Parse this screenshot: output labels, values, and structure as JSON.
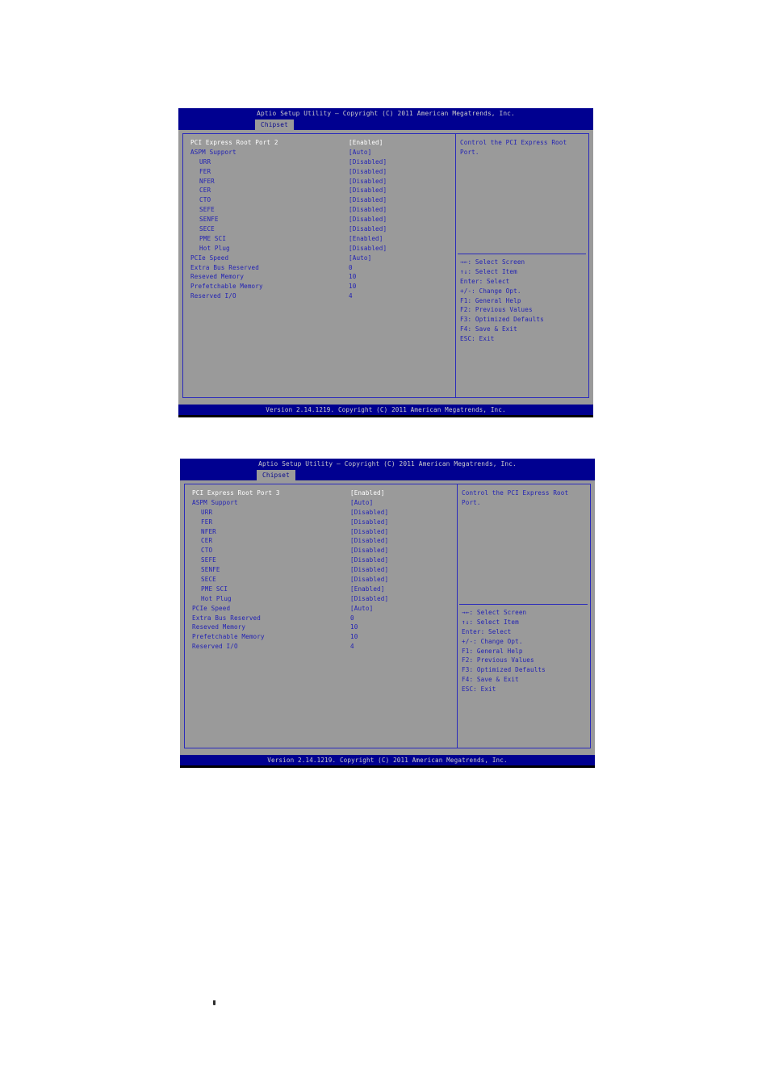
{
  "document": {
    "page_marker": ","
  },
  "screens": [
    {
      "id": "screen-port2",
      "title": "Aptio Setup Utility – Copyright (C) 2011 American Megatrends, Inc.",
      "tab": "Chipset",
      "footer": "Version 2.14.1219. Copyright (C) 2011 American Megatrends, Inc.",
      "help": "Control the PCI Express Root Port.",
      "options": [
        {
          "label": "PCI Express Root Port 2",
          "value": "[Enabled]",
          "indent": false,
          "selected": true
        },
        {
          "label": "ASPM Support",
          "value": "[Auto]",
          "indent": false,
          "selected": false
        },
        {
          "label": "URR",
          "value": "[Disabled]",
          "indent": true,
          "selected": false
        },
        {
          "label": "FER",
          "value": "[Disabled]",
          "indent": true,
          "selected": false
        },
        {
          "label": "NFER",
          "value": "[Disabled]",
          "indent": true,
          "selected": false
        },
        {
          "label": "CER",
          "value": "[Disabled]",
          "indent": true,
          "selected": false
        },
        {
          "label": "CTO",
          "value": "[Disabled]",
          "indent": true,
          "selected": false
        },
        {
          "label": "SEFE",
          "value": "[Disabled]",
          "indent": true,
          "selected": false
        },
        {
          "label": "SENFE",
          "value": "[Disabled]",
          "indent": true,
          "selected": false
        },
        {
          "label": "SECE",
          "value": "[Disabled]",
          "indent": true,
          "selected": false
        },
        {
          "label": "PME SCI",
          "value": "[Enabled]",
          "indent": true,
          "selected": false
        },
        {
          "label": "Hot Plug",
          "value": "[Disabled]",
          "indent": true,
          "selected": false
        },
        {
          "label": "PCIe Speed",
          "value": "[Auto]",
          "indent": false,
          "selected": false
        },
        {
          "label": "Extra Bus Reserved",
          "value": "0",
          "indent": false,
          "selected": false
        },
        {
          "label": "Reseved Memory",
          "value": "10",
          "indent": false,
          "selected": false
        },
        {
          "label": "Prefetchable Memory",
          "value": "10",
          "indent": false,
          "selected": false
        },
        {
          "label": "Reserved I/O",
          "value": "4",
          "indent": false,
          "selected": false
        }
      ],
      "keys": [
        "→←: Select Screen",
        "↑↓: Select Item",
        "Enter: Select",
        "+/-: Change Opt.",
        "F1: General Help",
        "F2: Previous Values",
        "F3: Optimized Defaults",
        "F4: Save & Exit",
        "ESC: Exit"
      ]
    },
    {
      "id": "screen-port3",
      "title": "Aptio Setup Utility – Copyright (C) 2011 American Megatrends, Inc.",
      "tab": "Chipset",
      "footer": "Version 2.14.1219. Copyright (C) 2011 American Megatrends, Inc.",
      "help": "Control the PCI Express Root Port.",
      "options": [
        {
          "label": "PCI Express Root Port 3",
          "value": "[Enabled]",
          "indent": false,
          "selected": true
        },
        {
          "label": "ASPM Support",
          "value": "[Auto]",
          "indent": false,
          "selected": false
        },
        {
          "label": "URR",
          "value": "[Disabled]",
          "indent": true,
          "selected": false
        },
        {
          "label": "FER",
          "value": "[Disabled]",
          "indent": true,
          "selected": false
        },
        {
          "label": "NFER",
          "value": "[Disabled]",
          "indent": true,
          "selected": false
        },
        {
          "label": "CER",
          "value": "[Disabled]",
          "indent": true,
          "selected": false
        },
        {
          "label": "CTO",
          "value": "[Disabled]",
          "indent": true,
          "selected": false
        },
        {
          "label": "SEFE",
          "value": "[Disabled]",
          "indent": true,
          "selected": false
        },
        {
          "label": "SENFE",
          "value": "[Disabled]",
          "indent": true,
          "selected": false
        },
        {
          "label": "SECE",
          "value": "[Disabled]",
          "indent": true,
          "selected": false
        },
        {
          "label": "PME SCI",
          "value": "[Enabled]",
          "indent": true,
          "selected": false
        },
        {
          "label": "Hot Plug",
          "value": "[Disabled]",
          "indent": true,
          "selected": false
        },
        {
          "label": "PCIe Speed",
          "value": "[Auto]",
          "indent": false,
          "selected": false
        },
        {
          "label": "Extra Bus Reserved",
          "value": "0",
          "indent": false,
          "selected": false
        },
        {
          "label": "Reseved Memory",
          "value": "10",
          "indent": false,
          "selected": false
        },
        {
          "label": "Prefetchable Memory",
          "value": "10",
          "indent": false,
          "selected": false
        },
        {
          "label": "Reserved I/O",
          "value": "4",
          "indent": false,
          "selected": false
        }
      ],
      "keys": [
        "→←: Select Screen",
        "↑↓: Select Item",
        "Enter: Select",
        "+/-: Change Opt.",
        "F1: General Help",
        "F2: Previous Values",
        "F3: Optimized Defaults",
        "F4: Save & Exit",
        "ESC: Exit"
      ]
    }
  ]
}
